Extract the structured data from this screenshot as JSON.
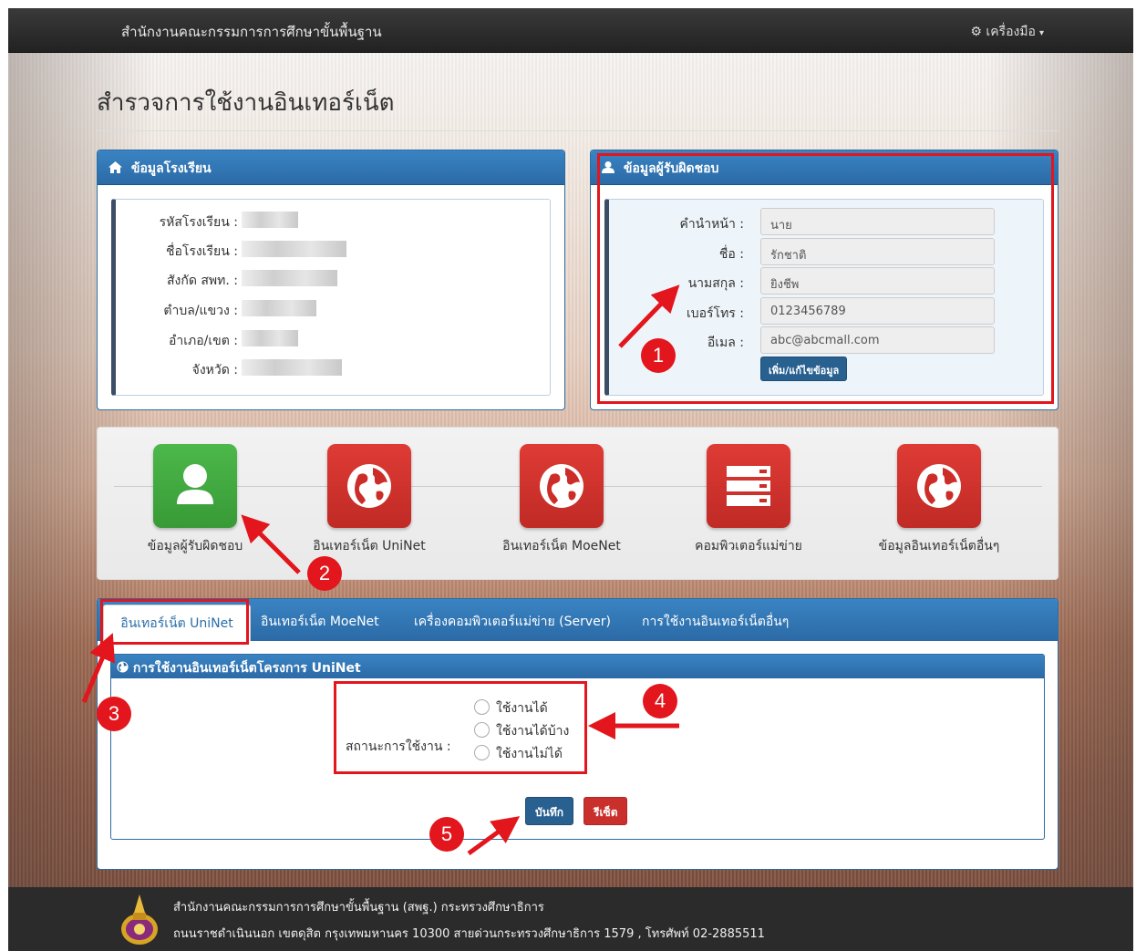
{
  "navbar": {
    "brand": "สำนักงานคณะกรรมการการศึกษาขั้นพื้นฐาน",
    "tools_label": "⚙ เครื่องมือ",
    "tools_caret": "▾"
  },
  "page_title": "สำรวจการใช้งานอินเทอร์เน็ต",
  "school_panel": {
    "title": "ข้อมูลโรงเรียน",
    "icon": "home-icon",
    "rows": [
      {
        "label": "รหัสโรงเรียน :"
      },
      {
        "label": "ชื่อโรงเรียน :"
      },
      {
        "label": "สังกัด สพท. :"
      },
      {
        "label": "ตำบล/แขวง :"
      },
      {
        "label": "อำเภอ/เขต :"
      },
      {
        "label": "จังหวัด :"
      }
    ]
  },
  "responsible_panel": {
    "title": "ข้อมูลผู้รับผิดชอบ",
    "icon": "user-icon",
    "fields": [
      {
        "label": "คำนำหน้า :",
        "value": "นาย"
      },
      {
        "label": "ชื่อ :",
        "value": "รักชาติ"
      },
      {
        "label": "นามสกุล :",
        "value": "ยิงชีพ"
      },
      {
        "label": "เบอร์โทร :",
        "value": "0123456789"
      },
      {
        "label": "อีเมล :",
        "value": "abc@abcmall.com"
      }
    ],
    "edit_button": "เพิ่ม/แก้ไขข้อมูล"
  },
  "menu_tiles": [
    {
      "label": "ข้อมูลผู้รับผิดชอบ",
      "icon": "user-icon",
      "color": "#43a941"
    },
    {
      "label": "อินเทอร์เน็ต UniNet",
      "icon": "globe-icon",
      "color": "#d0322d"
    },
    {
      "label": "อินเทอร์เน็ต MoeNet",
      "icon": "globe-icon",
      "color": "#d0322d"
    },
    {
      "label": "คอมพิวเตอร์แม่ข่าย",
      "icon": "server-icon",
      "color": "#d0322d"
    },
    {
      "label": "ข้อมูลอินเทอร์เน็ตอื่นๆ",
      "icon": "globe-icon",
      "color": "#d0322d"
    }
  ],
  "tabs": [
    {
      "label": "อินเทอร์เน็ต UniNet",
      "active": true
    },
    {
      "label": "อินเทอร์เน็ต MoeNet"
    },
    {
      "label": "เครื่องคอมพิวเตอร์แม่ข่าย (Server)"
    },
    {
      "label": "การใช้งานอินเทอร์เน็ตอื่นๆ"
    }
  ],
  "uninet_section": {
    "title": "การใช้งานอินเทอร์เน็ตโครงการ UniNet",
    "status_label": "สถานะการใช้งาน :",
    "options": [
      "ใช้งานได้",
      "ใช้งานได้บ้าง",
      "ใช้งานไม่ได้"
    ],
    "save_button": "บันทึก",
    "reset_button": "รีเซ็ต"
  },
  "footer": {
    "line1": "สำนักงานคณะกรรมการการศึกษาขั้นพื้นฐาน (สพฐ.) กระทรวงศึกษาธิการ",
    "line2": "ถนนราชดำเนินนอก เขตดุสิต กรุงเทพมหานคร 10300 สายด่วนกระทรวงศึกษาธิการ 1579 , โทรศัพท์ 02-2885511"
  },
  "callouts": [
    "1",
    "2",
    "3",
    "4",
    "5"
  ],
  "colors": {
    "accent": "#2b6aa6",
    "highlight": "#e2161c",
    "danger": "#c9302c",
    "primary": "#286090"
  }
}
